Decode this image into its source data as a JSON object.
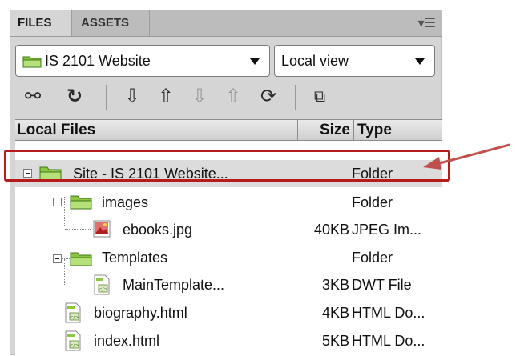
{
  "tabs": [
    {
      "label": "FILES",
      "active": true
    },
    {
      "label": "ASSETS",
      "active": false
    }
  ],
  "tab_menu_icon": "panel-menu-icon",
  "site_select": {
    "value": "IS 2101 Website",
    "icon": "folder-icon"
  },
  "view_select": {
    "value": "Local view"
  },
  "toolbar": [
    {
      "name": "connect-icon",
      "glyph": "⚯"
    },
    {
      "name": "refresh-icon",
      "glyph": "↻"
    },
    {
      "name": "get-files-icon",
      "glyph": "⇩"
    },
    {
      "name": "put-files-icon",
      "glyph": "⇧"
    },
    {
      "name": "check-out-icon",
      "glyph": "⇩"
    },
    {
      "name": "check-in-icon",
      "glyph": "⇧"
    },
    {
      "name": "synchronize-icon",
      "glyph": "⟳"
    },
    {
      "name": "expand-icon",
      "glyph": "⧉"
    }
  ],
  "columns": {
    "name": "Local Files",
    "size": "Size",
    "type": "Type"
  },
  "files": [
    {
      "name": "Site - IS 2101 Website...",
      "size": "",
      "type": "Folder",
      "kind": "folder",
      "level": 0,
      "selected": true
    },
    {
      "name": "images",
      "size": "",
      "type": "Folder",
      "kind": "folder",
      "level": 1
    },
    {
      "name": "ebooks.jpg",
      "size": "40KB",
      "type": "JPEG Im...",
      "kind": "image",
      "level": 2
    },
    {
      "name": "Templates",
      "size": "",
      "type": "Folder",
      "kind": "folder",
      "level": 1
    },
    {
      "name": "MainTemplate...",
      "size": "3KB",
      "type": "DWT File",
      "kind": "template",
      "level": 2
    },
    {
      "name": "biography.html",
      "size": "4KB",
      "type": "HTML Do...",
      "kind": "html",
      "level": 1
    },
    {
      "name": "index.html",
      "size": "5KB",
      "type": "HTML Do...",
      "kind": "html",
      "level": 1
    }
  ],
  "colors": {
    "callout": "#b71c1c",
    "arrow": "#c0504d",
    "folder_green": "#8dc63f"
  }
}
